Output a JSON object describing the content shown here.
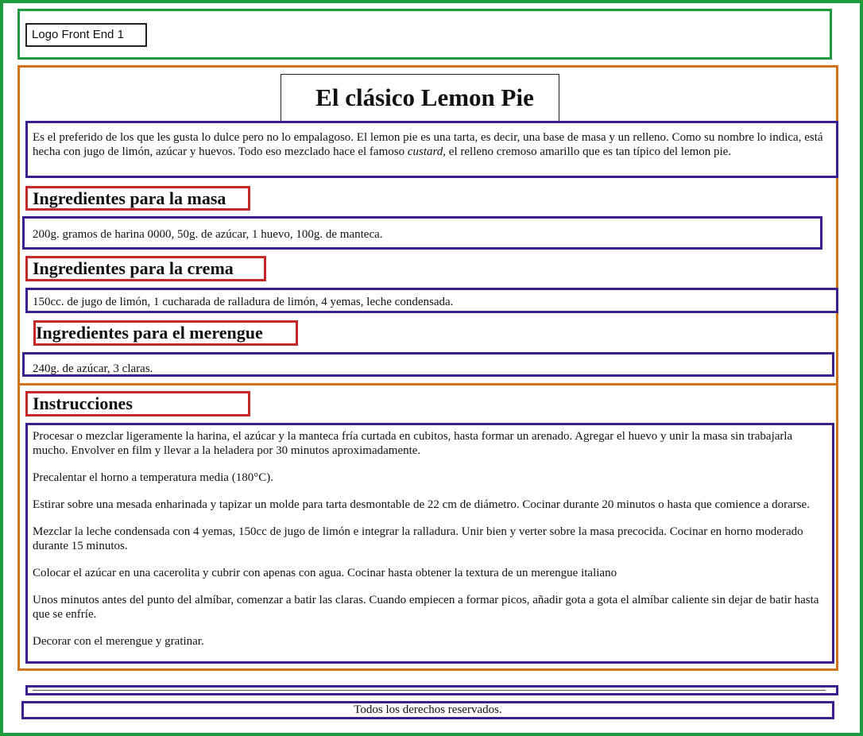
{
  "header": {
    "logo_text": "Logo Front End 1"
  },
  "article": {
    "title": "El clásico Lemon Pie",
    "intro_part1": "Es el preferido de los que les gusta lo dulce pero no lo empalagoso. El lemon pie es una tarta, es decir, una base de masa y un relleno. Como su nombre lo indica, está hecha con jugo de limón, azúcar y huevos. Todo eso mezclado hace el famoso ",
    "intro_em": "custard",
    "intro_part2": ", el relleno cremoso amarillo que es tan típico del lemon pie.",
    "sections": [
      {
        "heading": "Ingredientes para la masa",
        "text": "200g. gramos de harina 0000, 50g. de azúcar, 1 huevo, 100g. de manteca."
      },
      {
        "heading": "Ingredientes para la crema",
        "text": "150cc. de jugo de limón, 1 cucharada de ralladura de limón, 4 yemas, leche condensada."
      },
      {
        "heading": "Ingredientes para el merengue",
        "text": "240g. de azúcar, 3 claras."
      }
    ],
    "instructions_heading": "Instrucciones",
    "steps": [
      "Procesar o mezclar ligeramente la harina, el azúcar y la manteca fría curtada en cubitos, hasta formar un arenado. Agregar el huevo y unir la masa sin trabajarla mucho. Envolver en film y llevar a la heladera por 30 minutos aproximadamente.",
      "Precalentar el horno a temperatura media (180°C).",
      "Estirar sobre una mesada enharinada y tapizar un molde para tarta desmontable de 22 cm de diámetro. Cocinar durante 20 minutos o hasta que comience a dorarse.",
      "Mezclar la leche condensada con 4 yemas, 150cc de jugo de limón e integrar la ralladura. Unir bien y verter sobre la masa precocida. Cocinar en horno moderado durante 15 minutos.",
      "Colocar el azúcar en una cacerolita y cubrir con apenas con agua. Cocinar hasta obtener la textura de un merengue italiano",
      "Unos minutos antes del punto del almíbar, comenzar a batir las claras. Cuando empiecen a formar picos, añadir gota a gota el almíbar caliente sin dejar de batir hasta que se enfríe.",
      "Decorar con el merengue y gratinar."
    ]
  },
  "footer": {
    "text": "Todos los derechos reservados."
  },
  "colors": {
    "page_border": "#1f9a3e",
    "main_border": "#d2731c",
    "paragraph_border": "#3b1f8c",
    "heading_border": "#c62828"
  }
}
